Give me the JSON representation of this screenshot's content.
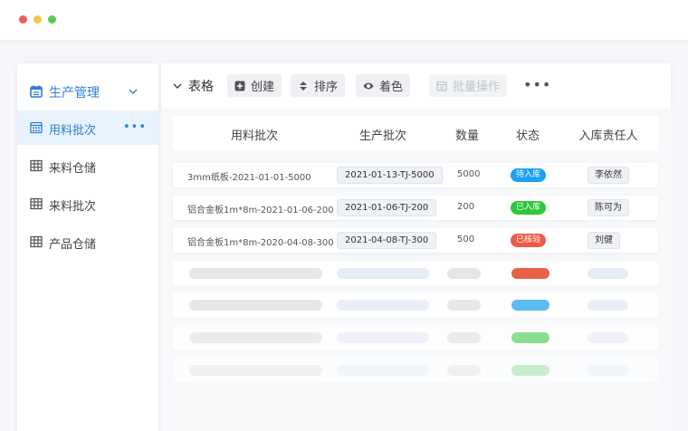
{
  "sidebar": {
    "header": {
      "label": "生产管理",
      "icon": "calendar-icon"
    },
    "items": [
      {
        "label": "用料批次",
        "icon": "calendar-grid-icon",
        "active": true,
        "more": "•••"
      },
      {
        "label": "来料仓储",
        "icon": "table-icon",
        "active": false
      },
      {
        "label": "来料批次",
        "icon": "table-icon",
        "active": false
      },
      {
        "label": "产品仓储",
        "icon": "table-icon",
        "active": false
      }
    ]
  },
  "toolbar": {
    "view_label": "表格",
    "create_label": "创建",
    "sort_label": "排序",
    "color_label": "着色",
    "batch_label": "批量操作",
    "more_label": "•••"
  },
  "table": {
    "columns": [
      "用料批次",
      "生产批次",
      "数量",
      "状态",
      "入库责任人"
    ],
    "rows": [
      {
        "material_batch": "3mm纸板-2021-01-01-5000",
        "production_batch": "2021-01-13-TJ-5000",
        "quantity": "5000",
        "status": "待入库",
        "status_color": "#1e9ff2",
        "owner": "李依然"
      },
      {
        "material_batch": "铝合金板1m*8m-2021-01-06-200",
        "production_batch": "2021-01-06-TJ-200",
        "quantity": "200",
        "status": "已入库",
        "status_color": "#2cc83c",
        "owner": "陈可为"
      },
      {
        "material_batch": "铝合金板1m*8m-2020-04-08-300",
        "production_batch": "2021-04-08-TJ-300",
        "quantity": "500",
        "status": "已核验",
        "status_color": "#ef5a46",
        "owner": "刘健"
      }
    ],
    "placeholder_status_colors": [
      "#e8604a",
      "#4db6ef",
      "#6fd878",
      "#a8e6ad"
    ]
  },
  "colors": {
    "accent": "#2b7fd9",
    "active_bg": "#e8f3fd"
  }
}
